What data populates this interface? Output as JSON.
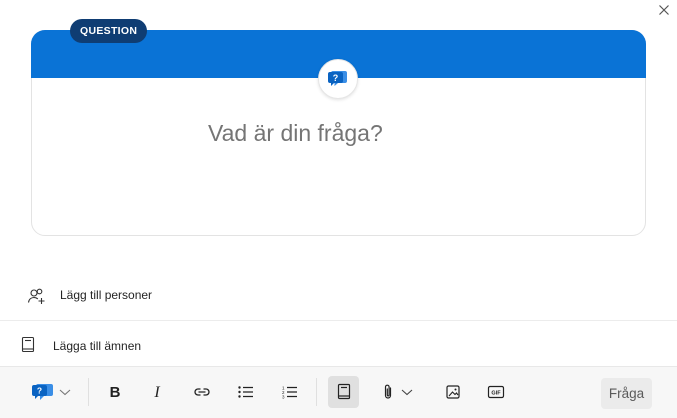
{
  "card": {
    "badge": "QUESTION",
    "question_placeholder": "Vad är din fråga?",
    "type_icon": "question-chat-icon",
    "accent_color": "#0a73d6",
    "badge_color": "#0f3d73"
  },
  "rows": {
    "add_people": "Lägg till personer",
    "add_topics": "Lägga till ämnen"
  },
  "toolbar": {
    "post_type_icon": "question-chat-icon",
    "tools": [
      "bold-icon",
      "italic-icon",
      "link-icon",
      "bulleted-list-icon",
      "numbered-list-icon",
      "topic-book-icon",
      "attach-icon",
      "image-icon",
      "gif-icon"
    ],
    "submit_label": "Fråga"
  }
}
